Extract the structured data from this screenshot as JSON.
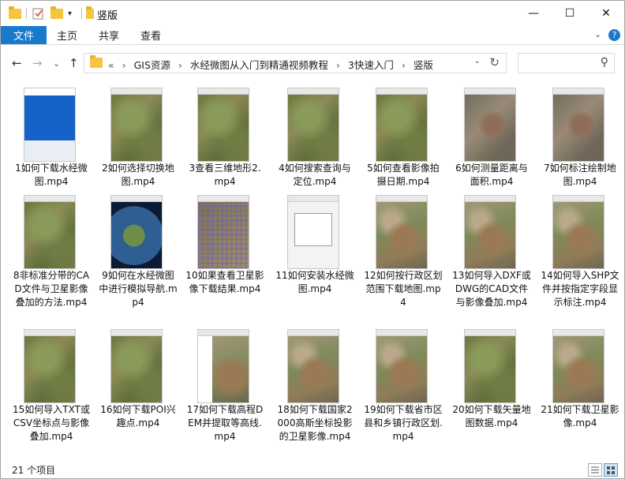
{
  "window": {
    "title": "竖版",
    "controls": {
      "minimize": "—",
      "maximize": "☐",
      "close": "✕"
    }
  },
  "ribbon": {
    "file": "文件",
    "tabs": [
      "主页",
      "共享",
      "查看"
    ],
    "expand": "⌄",
    "help": "?"
  },
  "nav": {
    "back": "←",
    "forward": "→",
    "recent": "⌄",
    "up": "↑",
    "overflow": "«",
    "breadcrumbs": [
      "GIS资源",
      "水经微图从入门到精通视频教程",
      "3快速入门",
      "竖版"
    ],
    "search_placeholder": ""
  },
  "files": [
    {
      "name": "1如何下载水经微图.mp4",
      "thumb": "web"
    },
    {
      "name": "2如何选择切换地图.mp4",
      "thumb": "map-green"
    },
    {
      "name": "3查看三维地形2.mp4",
      "thumb": "map-green"
    },
    {
      "name": "4如何搜索查询与定位.mp4",
      "thumb": "map-green"
    },
    {
      "name": "5如何查看影像拍摄日期.mp4",
      "thumb": "map-green"
    },
    {
      "name": "6如何测量距离与面积.mp4",
      "thumb": "map-city"
    },
    {
      "name": "7如何标注绘制地图.mp4",
      "thumb": "map-city"
    },
    {
      "name": "8非标准分带的CAD文件与卫星影像叠加的方法.mp4",
      "thumb": "map-green"
    },
    {
      "name": "9如何在水经微图中进行模拟导航.mp4",
      "thumb": "globe"
    },
    {
      "name": "10如果查看卫星影像下载结果.mp4",
      "thumb": "map-grid"
    },
    {
      "name": "11如何安装水经微图.mp4",
      "thumb": "dialog"
    },
    {
      "name": "12如何按行政区划范围下载地图.mp4",
      "thumb": "map-china"
    },
    {
      "name": "13如何导入DXF或DWG的CAD文件与影像叠加.mp4",
      "thumb": "map-china"
    },
    {
      "name": "14如何导入SHP文件并按指定字段显示标注.mp4",
      "thumb": "map-china"
    },
    {
      "name": "15如何导入TXT或CSV坐标点与影像叠加.mp4",
      "thumb": "map-green"
    },
    {
      "name": "16如何下载POI兴趣点.mp4",
      "thumb": "map-green"
    },
    {
      "name": "17如何下载高程DEM并提取等高线.mp4",
      "thumb": "map-tree"
    },
    {
      "name": "18如何下载国家2000高斯坐标投影的卫星影像.mp4",
      "thumb": "map-china"
    },
    {
      "name": "19如何下载省市区县和乡镇行政区划.mp4",
      "thumb": "map-china"
    },
    {
      "name": "20如何下载矢量地图数据.mp4",
      "thumb": "map-green"
    },
    {
      "name": "21如何下载卫星影像.mp4",
      "thumb": "map-china"
    }
  ],
  "status": {
    "count": "21 个项目"
  },
  "colors": {
    "accent": "#1979ca",
    "folder": "#f5c542"
  }
}
